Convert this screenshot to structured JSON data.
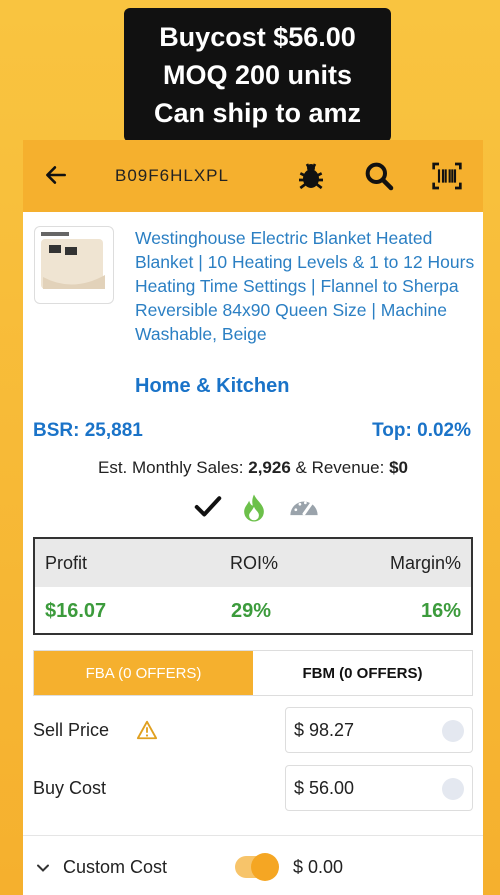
{
  "caption": {
    "line1": "Buycost $56.00",
    "line2": "MOQ 200 units",
    "line3": "Can ship to amz"
  },
  "topbar": {
    "asin": "B09F6HLXPL",
    "icons": [
      "back-arrow-icon",
      "bug-icon",
      "search-icon",
      "barcode-icon"
    ]
  },
  "product": {
    "title": "Westinghouse Electric Blanket Heated Blanket | 10 Heating Levels & 1 to 12 Hours Heating Time Settings | Flannel to Sherpa Reversible 84x90 Queen Size | Machine Washable, Beige",
    "category": "Home & Kitchen",
    "bsr": "BSR: 25,881",
    "top": "Top: 0.02%"
  },
  "sales": {
    "prefix": "Est. Monthly Sales: ",
    "units": "2,926",
    "mid": " & Revenue: ",
    "revenue": "$0"
  },
  "indicators": [
    "check-icon",
    "flame-icon",
    "gauge-icon"
  ],
  "profit": {
    "headers": [
      "Profit",
      "ROI%",
      "Margin%"
    ],
    "values": [
      "$16.07",
      "29%",
      "16%"
    ]
  },
  "tabs": [
    {
      "label": "FBA (0 OFFERS)"
    },
    {
      "label": "FBM (0 OFFERS)"
    }
  ],
  "fields": {
    "sell_price": {
      "label": "Sell Price",
      "value": "$  98.27"
    },
    "buy_cost": {
      "label": "Buy Cost",
      "value": "$  56.00"
    },
    "custom_cost": {
      "label": "Custom Cost",
      "value": "$  0.00"
    }
  },
  "colors": {
    "accent": "#f5b02e",
    "link": "#2b7fc3",
    "profit_green": "#3c9b3c"
  }
}
